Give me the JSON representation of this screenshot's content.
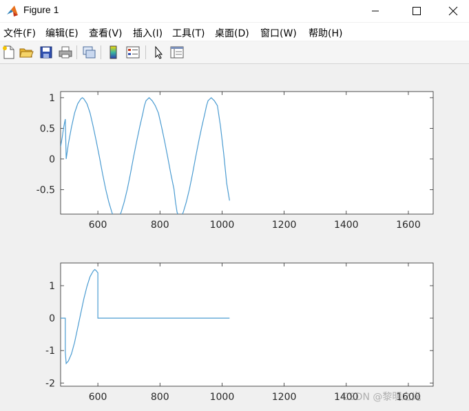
{
  "window": {
    "title": "Figure 1",
    "icon": "matlab-icon",
    "controls": [
      "minimize-icon",
      "maximize-icon",
      "close-icon"
    ]
  },
  "menu": {
    "items": [
      "文件(F)",
      "编辑(E)",
      "查看(V)",
      "插入(I)",
      "工具(T)",
      "桌面(D)",
      "窗口(W)",
      "帮助(H)"
    ]
  },
  "toolbar": {
    "buttons": [
      "new-figure-icon",
      "open-file-icon",
      "save-icon",
      "print-icon",
      "link-plot-icon",
      "colorbar-icon",
      "legend-icon",
      "edit-plot-arrow-icon",
      "property-inspector-icon"
    ]
  },
  "colors": {
    "line": "#4a9bd1",
    "axes": "#262626"
  },
  "watermark": "CSDN @黎明之光",
  "chart_data": [
    {
      "type": "line",
      "xlim": [
        480,
        1680
      ],
      "ylim": [
        -0.9,
        1.1
      ],
      "xticks": [
        600,
        800,
        1000,
        1200,
        1400,
        1600
      ],
      "yticks": [
        1,
        0.5,
        0,
        -0.5
      ],
      "xtick_labels": [
        "600",
        "800",
        "1000",
        "1200",
        "1400",
        "1600"
      ],
      "ytick_labels": [
        "1",
        "0.5",
        "0",
        "-0.5"
      ],
      "series": [
        {
          "x": [
            480,
            485,
            490,
            495,
            498,
            505,
            515,
            525,
            535,
            545,
            550,
            555,
            565,
            575,
            585,
            595,
            605,
            615,
            625,
            635,
            645,
            650,
            655,
            665,
            675,
            685,
            695,
            705,
            715,
            725,
            735,
            745,
            750,
            755,
            765,
            775,
            785,
            795,
            805,
            815,
            825,
            835,
            845,
            850,
            855,
            865,
            875,
            885,
            895,
            905,
            915,
            925,
            935,
            945,
            950,
            955,
            965,
            975,
            985,
            995,
            1005,
            1015,
            1024
          ],
          "y": [
            0.2,
            0.35,
            0.52,
            0.65,
            0.0,
            0.25,
            0.52,
            0.75,
            0.9,
            0.98,
            1.0,
            0.98,
            0.9,
            0.75,
            0.53,
            0.29,
            0.03,
            -0.24,
            -0.49,
            -0.7,
            -0.87,
            -0.93,
            -0.97,
            -0.98,
            -0.87,
            -0.7,
            -0.49,
            -0.24,
            0.03,
            0.29,
            0.53,
            0.75,
            0.87,
            0.95,
            1.0,
            0.95,
            0.87,
            0.75,
            0.53,
            0.29,
            0.03,
            -0.24,
            -0.49,
            -0.7,
            -0.87,
            -0.98,
            -0.87,
            -0.7,
            -0.49,
            -0.24,
            0.03,
            0.29,
            0.53,
            0.75,
            0.87,
            0.95,
            1.0,
            0.95,
            0.87,
            0.53,
            0.1,
            -0.4,
            -0.68
          ]
        }
      ]
    },
    {
      "type": "line",
      "xlim": [
        480,
        1680
      ],
      "ylim": [
        -2.1,
        1.7
      ],
      "xticks": [
        600,
        800,
        1000,
        1200,
        1400,
        1600
      ],
      "yticks": [
        1,
        0,
        -1,
        -2
      ],
      "xtick_labels": [
        "600",
        "800",
        "1000",
        "1200",
        "1400",
        "1600"
      ],
      "ytick_labels": [
        "1",
        "0",
        "-1",
        "-2"
      ],
      "series": [
        {
          "x": [
            480,
            495,
            495,
            498,
            505,
            515,
            525,
            535,
            545,
            555,
            565,
            575,
            585,
            590,
            595,
            598,
            600,
            600,
            700,
            800,
            900,
            1000,
            1024
          ],
          "y": [
            0,
            0,
            -1.05,
            -1.4,
            -1.32,
            -1.1,
            -0.75,
            -0.3,
            0.15,
            0.6,
            0.98,
            1.28,
            1.45,
            1.5,
            1.46,
            1.42,
            1.4,
            0,
            0,
            0,
            0,
            0,
            0
          ]
        }
      ]
    }
  ]
}
